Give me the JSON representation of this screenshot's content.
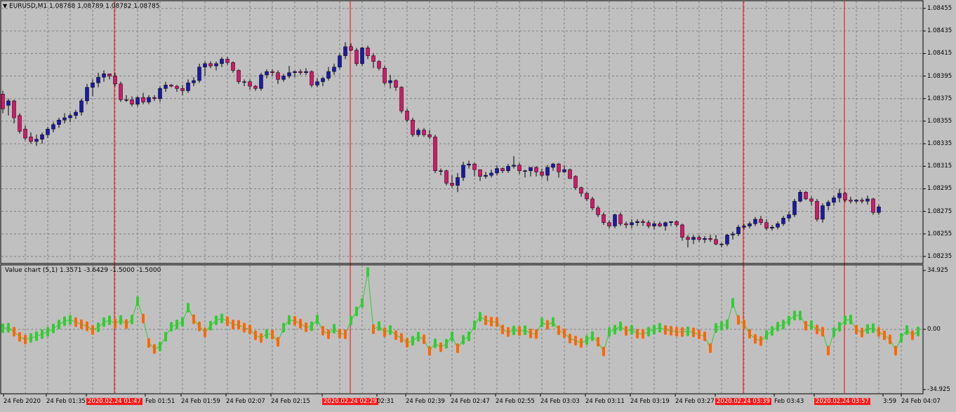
{
  "window": {
    "symbol_line": "EURUSD,M1  1.08788 1.08789 1.08782 1.08785",
    "indicator_line": "Value chart (5,1) 1.3571 -3.6429 -1.5000 -1.5000"
  },
  "price_axis": {
    "labels": [
      "1.08455",
      "1.08435",
      "1.08415",
      "1.08395",
      "1.08375",
      "1.08355",
      "1.08335",
      "1.08315",
      "1.08295",
      "1.08275",
      "1.08255",
      "1.08235"
    ]
  },
  "osc_axis": {
    "labels": [
      "34.925",
      "0.00",
      "-34.925"
    ]
  },
  "time_axis": {
    "labels": [
      {
        "text": "24 Feb 2020",
        "hl": false
      },
      {
        "text": "24 Feb 01:35",
        "hl": false
      },
      {
        "text": "2020.02.24 01:47",
        "hl": true
      },
      {
        "text": "Feb 01:51",
        "hl": false
      },
      {
        "text": "24 Feb 01:59",
        "hl": false
      },
      {
        "text": "24 Feb 02:07",
        "hl": false
      },
      {
        "text": "24 Feb 02:15",
        "hl": false
      },
      {
        "text": "2020.02.24 02:29",
        "hl": true
      },
      {
        "text": "02:31",
        "hl": false
      },
      {
        "text": "24 Feb 02:39",
        "hl": false
      },
      {
        "text": "24 Feb 02:47",
        "hl": false
      },
      {
        "text": "24 Feb 02:55",
        "hl": false
      },
      {
        "text": "24 Feb 03:03",
        "hl": false
      },
      {
        "text": "24 Feb 03:11",
        "hl": false
      },
      {
        "text": "24 Feb 03:19",
        "hl": false
      },
      {
        "text": "24 Feb 03:27",
        "hl": false
      },
      {
        "text": "2020.02.24 03:39",
        "hl": true
      },
      {
        "text": "Feb 03:43",
        "hl": false
      },
      {
        "text": "2020.02.24 03:57",
        "hl": true
      },
      {
        "text": "3:59",
        "hl": false
      },
      {
        "text": "24 Feb 04:07",
        "hl": false
      }
    ]
  },
  "colors": {
    "background": "#c0c0c0",
    "grid": "#808080",
    "bull_candle": "#1a1aa6",
    "bear_candle": "#d4176a",
    "wick": "#000000",
    "osc_up": "#33cc33",
    "osc_down": "#ff6600",
    "signal_line": "#ff0000"
  },
  "chart_data": {
    "type": "candlestick",
    "symbol": "EURUSD",
    "timeframe": "M1",
    "ylim": [
      1.0823,
      1.0846
    ],
    "candles": [
      [
        1.08379,
        1.08382,
        1.08362,
        1.08366
      ],
      [
        1.08369,
        1.08375,
        1.0836,
        1.08373
      ],
      [
        1.08373,
        1.08374,
        1.08353,
        1.08358
      ],
      [
        1.0836,
        1.08362,
        1.08344,
        1.08346
      ],
      [
        1.08348,
        1.08351,
        1.08338,
        1.0834
      ],
      [
        1.08341,
        1.08345,
        1.08335,
        1.08337
      ],
      [
        1.08337,
        1.08343,
        1.08333,
        1.08339
      ],
      [
        1.08339,
        1.08345,
        1.08335,
        1.08343
      ],
      [
        1.08343,
        1.0835,
        1.0834,
        1.08348
      ],
      [
        1.08348,
        1.08354,
        1.08345,
        1.08352
      ],
      [
        1.08352,
        1.08358,
        1.08349,
        1.08356
      ],
      [
        1.08356,
        1.08362,
        1.08353,
        1.08358
      ],
      [
        1.08358,
        1.08362,
        1.08354,
        1.0836
      ],
      [
        1.0836,
        1.08365,
        1.08357,
        1.08363
      ],
      [
        1.08363,
        1.08375,
        1.0836,
        1.08373
      ],
      [
        1.08373,
        1.08388,
        1.0837,
        1.08385
      ],
      [
        1.08385,
        1.08392,
        1.08377,
        1.08389
      ],
      [
        1.08389,
        1.08398,
        1.08385,
        1.08394
      ],
      [
        1.08394,
        1.084,
        1.0839,
        1.08397
      ],
      [
        1.08397,
        1.08397,
        1.08392,
        1.08395
      ],
      [
        1.08395,
        1.08398,
        1.08386,
        1.08388
      ],
      [
        1.08388,
        1.0839,
        1.08372,
        1.08374
      ],
      [
        1.08374,
        1.08378,
        1.08372,
        1.08374
      ],
      [
        1.08374,
        1.08377,
        1.08368,
        1.0837
      ],
      [
        1.0837,
        1.08377,
        1.08368,
        1.08376
      ],
      [
        1.08376,
        1.0838,
        1.0837,
        1.08372
      ],
      [
        1.08372,
        1.08378,
        1.0837,
        1.08376
      ],
      [
        1.08376,
        1.08378,
        1.08373,
        1.08375
      ],
      [
        1.08375,
        1.08386,
        1.08372,
        1.08384
      ],
      [
        1.08384,
        1.0839,
        1.08381,
        1.08387
      ],
      [
        1.08387,
        1.08388,
        1.08385,
        1.08386
      ],
      [
        1.08386,
        1.08387,
        1.08381,
        1.08384
      ],
      [
        1.08384,
        1.08387,
        1.08378,
        1.08382
      ],
      [
        1.08382,
        1.08392,
        1.0838,
        1.08389
      ],
      [
        1.08389,
        1.08394,
        1.08386,
        1.08391
      ],
      [
        1.08391,
        1.08406,
        1.08389,
        1.08403
      ],
      [
        1.08403,
        1.08408,
        1.08395,
        1.08406
      ],
      [
        1.08406,
        1.08408,
        1.08402,
        1.08404
      ],
      [
        1.08404,
        1.08408,
        1.084,
        1.08406
      ],
      [
        1.08406,
        1.08412,
        1.08403,
        1.0841
      ],
      [
        1.0841,
        1.08412,
        1.08405,
        1.08407
      ],
      [
        1.08407,
        1.08408,
        1.08398,
        1.084
      ],
      [
        1.084,
        1.08401,
        1.08388,
        1.0839
      ],
      [
        1.0839,
        1.08392,
        1.08386,
        1.0839
      ],
      [
        1.0839,
        1.08392,
        1.08383,
        1.08386
      ],
      [
        1.08386,
        1.08387,
        1.08382,
        1.08384
      ],
      [
        1.08384,
        1.08398,
        1.08382,
        1.08396
      ],
      [
        1.08396,
        1.08401,
        1.08393,
        1.08399
      ],
      [
        1.08399,
        1.08401,
        1.08395,
        1.08398
      ],
      [
        1.08398,
        1.084,
        1.08388,
        1.08392
      ],
      [
        1.08392,
        1.08397,
        1.0839,
        1.08395
      ],
      [
        1.08395,
        1.08404,
        1.08393,
        1.08398
      ],
      [
        1.08398,
        1.084,
        1.08394,
        1.08399
      ],
      [
        1.08399,
        1.08401,
        1.08396,
        1.08398
      ],
      [
        1.08398,
        1.08402,
        1.08396,
        1.08399
      ],
      [
        1.08399,
        1.084,
        1.08385,
        1.08387
      ],
      [
        1.08387,
        1.08393,
        1.08385,
        1.0839
      ],
      [
        1.0839,
        1.08394,
        1.08386,
        1.08393
      ],
      [
        1.08393,
        1.08403,
        1.08391,
        1.08399
      ],
      [
        1.08399,
        1.08406,
        1.08396,
        1.08403
      ],
      [
        1.08403,
        1.08415,
        1.08401,
        1.08413
      ],
      [
        1.08413,
        1.08425,
        1.0841,
        1.08421
      ],
      [
        1.08421,
        1.08424,
        1.08417,
        1.08418
      ],
      [
        1.08418,
        1.0842,
        1.08404,
        1.08406
      ],
      [
        1.08406,
        1.08421,
        1.08404,
        1.0842
      ],
      [
        1.0842,
        1.08422,
        1.0841,
        1.08413
      ],
      [
        1.08413,
        1.08415,
        1.08402,
        1.08408
      ],
      [
        1.08408,
        1.08409,
        1.084,
        1.08402
      ],
      [
        1.08402,
        1.08404,
        1.08387,
        1.08389
      ],
      [
        1.08389,
        1.08396,
        1.08384,
        1.08391
      ],
      [
        1.08391,
        1.08392,
        1.08382,
        1.08385
      ],
      [
        1.08385,
        1.08386,
        1.08362,
        1.08364
      ],
      [
        1.08364,
        1.08366,
        1.08354,
        1.08356
      ],
      [
        1.08356,
        1.08358,
        1.08341,
        1.08343
      ],
      [
        1.08343,
        1.08349,
        1.08341,
        1.08347
      ],
      [
        1.08347,
        1.08349,
        1.08341,
        1.08343
      ],
      [
        1.08343,
        1.08347,
        1.08339,
        1.08341
      ],
      [
        1.08341,
        1.08343,
        1.08309,
        1.08311
      ],
      [
        1.08311,
        1.08313,
        1.08307,
        1.08311
      ],
      [
        1.08311,
        1.08312,
        1.08298,
        1.083
      ],
      [
        1.083,
        1.08307,
        1.08296,
        1.08298
      ],
      [
        1.08298,
        1.08309,
        1.08292,
        1.08305
      ],
      [
        1.08305,
        1.08319,
        1.08302,
        1.08316
      ],
      [
        1.08316,
        1.0832,
        1.08313,
        1.08317
      ],
      [
        1.08317,
        1.08318,
        1.08306,
        1.08312
      ],
      [
        1.08312,
        1.08312,
        1.08302,
        1.08306
      ],
      [
        1.08306,
        1.0831,
        1.08304,
        1.08307
      ],
      [
        1.08307,
        1.08312,
        1.08305,
        1.08309
      ],
      [
        1.08309,
        1.08316,
        1.08307,
        1.08313
      ],
      [
        1.08313,
        1.08314,
        1.08309,
        1.08311
      ],
      [
        1.08311,
        1.08317,
        1.08309,
        1.08315
      ],
      [
        1.08315,
        1.08324,
        1.08313,
        1.08316
      ],
      [
        1.08316,
        1.08318,
        1.08308,
        1.08311
      ],
      [
        1.08311,
        1.08312,
        1.08305,
        1.08311
      ],
      [
        1.08311,
        1.08314,
        1.08306,
        1.08314
      ],
      [
        1.08314,
        1.08315,
        1.08306,
        1.0831
      ],
      [
        1.0831,
        1.08313,
        1.08305,
        1.08307
      ],
      [
        1.08307,
        1.08316,
        1.08302,
        1.08314
      ],
      [
        1.08314,
        1.08318,
        1.08311,
        1.08317
      ],
      [
        1.08317,
        1.08318,
        1.08305,
        1.0831
      ],
      [
        1.0831,
        1.08316,
        1.08309,
        1.08312
      ],
      [
        1.08312,
        1.08313,
        1.08305,
        1.08304
      ],
      [
        1.08306,
        1.08307,
        1.08294,
        1.08296
      ],
      [
        1.08296,
        1.08297,
        1.08288,
        1.08291
      ],
      [
        1.08291,
        1.08292,
        1.08284,
        1.08286
      ],
      [
        1.08286,
        1.08288,
        1.08276,
        1.08278
      ],
      [
        1.08278,
        1.0828,
        1.0827,
        1.08272
      ],
      [
        1.08272,
        1.08274,
        1.08263,
        1.08265
      ],
      [
        1.08265,
        1.08267,
        1.0826,
        1.08262
      ],
      [
        1.08262,
        1.08273,
        1.0826,
        1.08272
      ],
      [
        1.08272,
        1.08274,
        1.08262,
        1.08264
      ],
      [
        1.08264,
        1.08266,
        1.0826,
        1.08263
      ],
      [
        1.08263,
        1.08268,
        1.0826,
        1.08265
      ],
      [
        1.08265,
        1.08268,
        1.08262,
        1.08266
      ],
      [
        1.08266,
        1.08268,
        1.08262,
        1.08265
      ],
      [
        1.08265,
        1.08267,
        1.0826,
        1.08262
      ],
      [
        1.08262,
        1.08266,
        1.08259,
        1.08264
      ],
      [
        1.08264,
        1.08266,
        1.08261,
        1.08262
      ],
      [
        1.08262,
        1.08266,
        1.08258,
        1.08265
      ],
      [
        1.08265,
        1.08266,
        1.08262,
        1.08266
      ],
      [
        1.08266,
        1.08267,
        1.08261,
        1.08263
      ],
      [
        1.08263,
        1.08264,
        1.08249,
        1.08252
      ],
      [
        1.08252,
        1.08254,
        1.08243,
        1.0825
      ],
      [
        1.0825,
        1.08254,
        1.08246,
        1.08252
      ],
      [
        1.08252,
        1.08254,
        1.08248,
        1.0825
      ],
      [
        1.0825,
        1.08253,
        1.08247,
        1.08251
      ],
      [
        1.08251,
        1.08254,
        1.08248,
        1.0825
      ],
      [
        1.0825,
        1.08254,
        1.08245,
        1.08246
      ],
      [
        1.08246,
        1.08247,
        1.08243,
        1.08246
      ],
      [
        1.08246,
        1.08255,
        1.08244,
        1.08254
      ],
      [
        1.08254,
        1.08257,
        1.0825,
        1.08255
      ],
      [
        1.08255,
        1.08263,
        1.08253,
        1.08261
      ],
      [
        1.08261,
        1.08264,
        1.08259,
        1.08262
      ],
      [
        1.08262,
        1.08266,
        1.0826,
        1.08264
      ],
      [
        1.08264,
        1.0827,
        1.08262,
        1.08268
      ],
      [
        1.08268,
        1.08271,
        1.08263,
        1.08265
      ],
      [
        1.08265,
        1.08268,
        1.08258,
        1.0826
      ],
      [
        1.0826,
        1.08263,
        1.08258,
        1.08261
      ],
      [
        1.08261,
        1.08266,
        1.08259,
        1.08264
      ],
      [
        1.08264,
        1.08271,
        1.08262,
        1.08269
      ],
      [
        1.08269,
        1.08275,
        1.08266,
        1.08272
      ],
      [
        1.08272,
        1.08286,
        1.0827,
        1.08284
      ],
      [
        1.08284,
        1.08294,
        1.08283,
        1.08292
      ],
      [
        1.08292,
        1.08293,
        1.08285,
        1.08286
      ],
      [
        1.08286,
        1.08288,
        1.0828,
        1.08284
      ],
      [
        1.08284,
        1.08286,
        1.08266,
        1.08268
      ],
      [
        1.08268,
        1.08282,
        1.08265,
        1.0828
      ],
      [
        1.0828,
        1.08285,
        1.08276,
        1.08283
      ],
      [
        1.08283,
        1.08289,
        1.0828,
        1.08287
      ],
      [
        1.08287,
        1.08295,
        1.08283,
        1.08291
      ],
      [
        1.08291,
        1.08292,
        1.08283,
        1.08285
      ],
      [
        1.08285,
        1.08288,
        1.08282,
        1.08284
      ],
      [
        1.08284,
        1.08286,
        1.08282,
        1.08285
      ],
      [
        1.08285,
        1.08287,
        1.08282,
        1.08284
      ],
      [
        1.08284,
        1.08289,
        1.08281,
        1.08286
      ],
      [
        1.08286,
        1.08287,
        1.08272,
        1.08274
      ],
      [
        1.08274,
        1.08281,
        1.08272,
        1.08279
      ]
    ],
    "oscillator": {
      "name": "Value chart",
      "params": "(5,1)",
      "range": [
        -34.925,
        34.925
      ],
      "points": [
        0.6,
        0.9,
        -1.4,
        -4.4,
        -6.0,
        -5.1,
        -4.0,
        -2.8,
        -1.5,
        0.5,
        2.8,
        4.8,
        5.6,
        4.2,
        3.0,
        1.8,
        -0.4,
        1.2,
        4.2,
        5.3,
        3.4,
        5.5,
        3.1,
        5.8,
        16.5,
        6.3,
        -8.0,
        -11.5,
        -10.1,
        -4.3,
        1.5,
        2.9,
        4.3,
        12.7,
        5.9,
        1.7,
        -1.8,
        2.1,
        5.3,
        6.4,
        4.8,
        2.8,
        2.6,
        1.0,
        -0.1,
        -3.5,
        -5.1,
        -2.7,
        -3.1,
        -7.3,
        1.0,
        5.5,
        5.0,
        3.3,
        1.2,
        1.8,
        5.8,
        -0.8,
        -2.9,
        0.4,
        -2.4,
        -2.9,
        5.2,
        10.5,
        15.5,
        33.6,
        0.1,
        1.9,
        -1.7,
        -0.4,
        -3.4,
        -5.0,
        -7.9,
        -6.7,
        -4.3,
        -5.8,
        -12.7,
        -8.2,
        -10.5,
        -8.4,
        -4.1,
        -11.1,
        -6.1,
        -4.1,
        2.4,
        7.4,
        5.3,
        4.5,
        4.2,
        -0.1,
        -1.6,
        -0.6,
        -1.0,
        -0.5,
        -2.4,
        -2.7,
        4.0,
        2.6,
        4.3,
        -0.5,
        -2.3,
        -5.4,
        -6.6,
        -8.0,
        -6.3,
        -4.0,
        -7.3,
        -13.0,
        -1.5,
        -0.2,
        1.8,
        -0.9,
        -0.3,
        -2.5,
        -2.7,
        -1.4,
        -0.2,
        1.0,
        -0.4,
        -0.8,
        -1.4,
        -1.6,
        -1.2,
        -1.8,
        -3.0,
        -4.1,
        -11.0,
        0.8,
        2.0,
        3.0,
        15.5,
        5.5,
        2.9,
        -2.6,
        -5.6,
        -6.9,
        -3.4,
        -1.0,
        1.6,
        2.8,
        5.2,
        8.1,
        8.1,
        2.1,
        2.5,
        -0.1,
        -1.4,
        -12.5,
        -1.7,
        1.5,
        5.3,
        5.7,
        -0.2,
        -1.9,
        0.2,
        0.7,
        -1.5,
        -3.5,
        -5.9,
        -12.5,
        -5.0,
        -0.4,
        -3.5,
        -1.3,
        -2.4,
        -6.3,
        -8.1,
        -12.0,
        -4.4,
        -4.5,
        -2.0,
        -0.5,
        -0.4,
        -1.0,
        -0.4,
        -1.7,
        -1.9,
        -3.0,
        -4.4,
        -3.3,
        -1.5
      ]
    },
    "signal_marks": [
      "2020.02.24 01:47",
      "2020.02.24 02:29",
      "2020.02.24 03:39",
      "2020.02.24 03:57"
    ]
  }
}
